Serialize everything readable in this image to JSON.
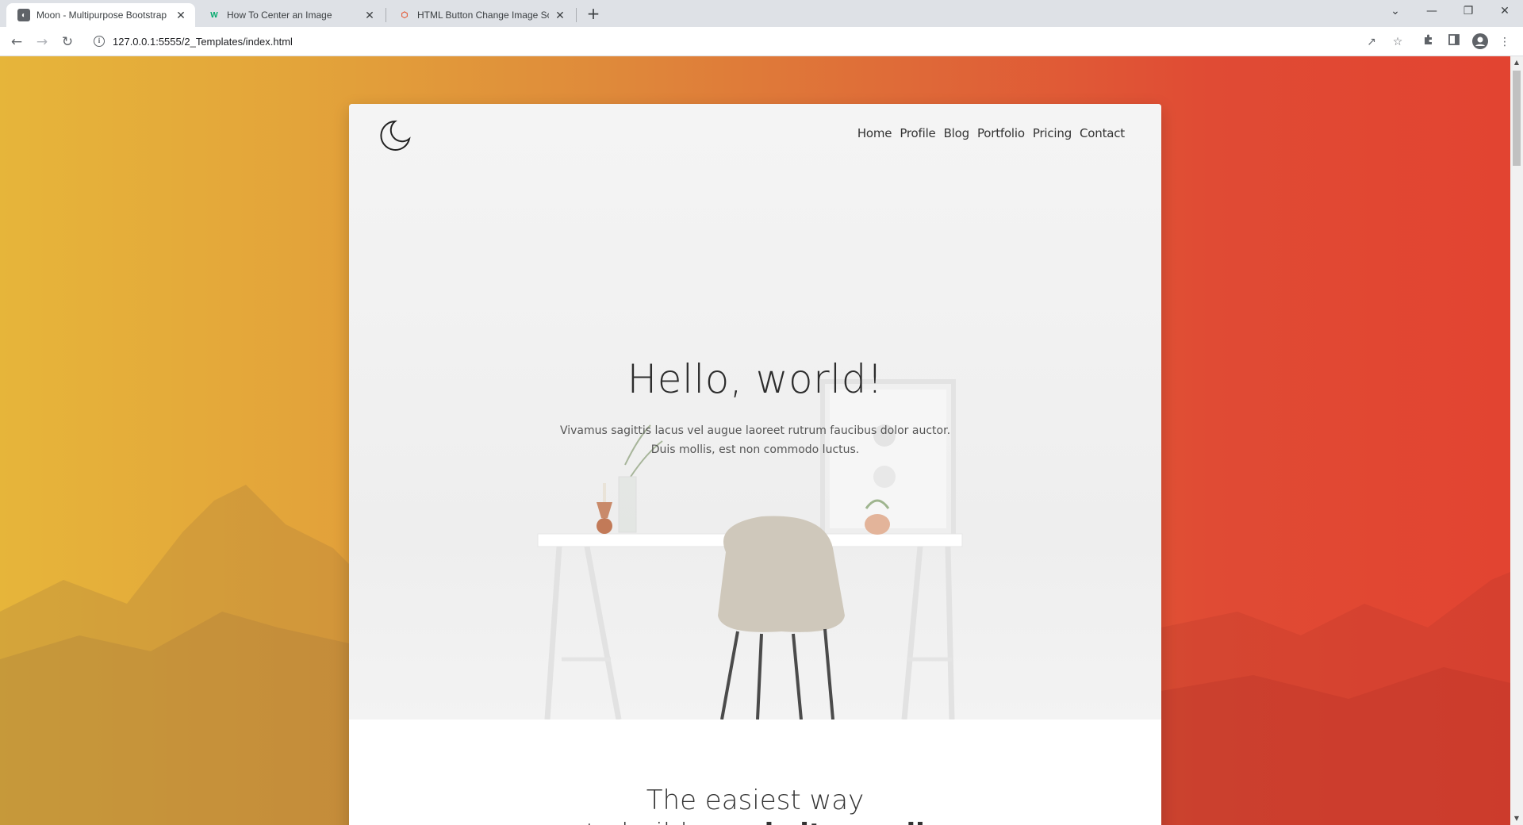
{
  "browser": {
    "tabs": [
      {
        "title": "Moon - Multipurpose Bootstrap",
        "icon": "moon-favicon",
        "active": true
      },
      {
        "title": "How To Center an Image",
        "icon": "w-favicon",
        "active": false
      },
      {
        "title": "HTML Button Change Image So",
        "icon": "html-favicon",
        "active": false
      }
    ],
    "new_tab_glyph": "+",
    "url": "127.0.0.1:5555/2_Templates/index.html",
    "window_controls": {
      "minimize": "—",
      "restore": "❐",
      "close": "✕",
      "tab_search": "⌄"
    }
  },
  "page": {
    "nav": [
      "Home",
      "Profile",
      "Blog",
      "Portfolio",
      "Pricing",
      "Contact"
    ],
    "hero": {
      "title": "Hello, world!",
      "text_line1": "Vivamus sagittis lacus vel augue laoreet rutrum faucibus dolor auctor.",
      "text_line2": "Duis mollis, est non commodo luctus."
    },
    "section2": {
      "title": "The easiest way",
      "subtitle_start": "to build a ",
      "subtitle_bold": "website quali"
    }
  },
  "colors": {
    "gradient_left": "#e6b53a",
    "gradient_right": "#e24431",
    "card_bg": "#ffffff",
    "text_dark": "#2d2d2d"
  }
}
